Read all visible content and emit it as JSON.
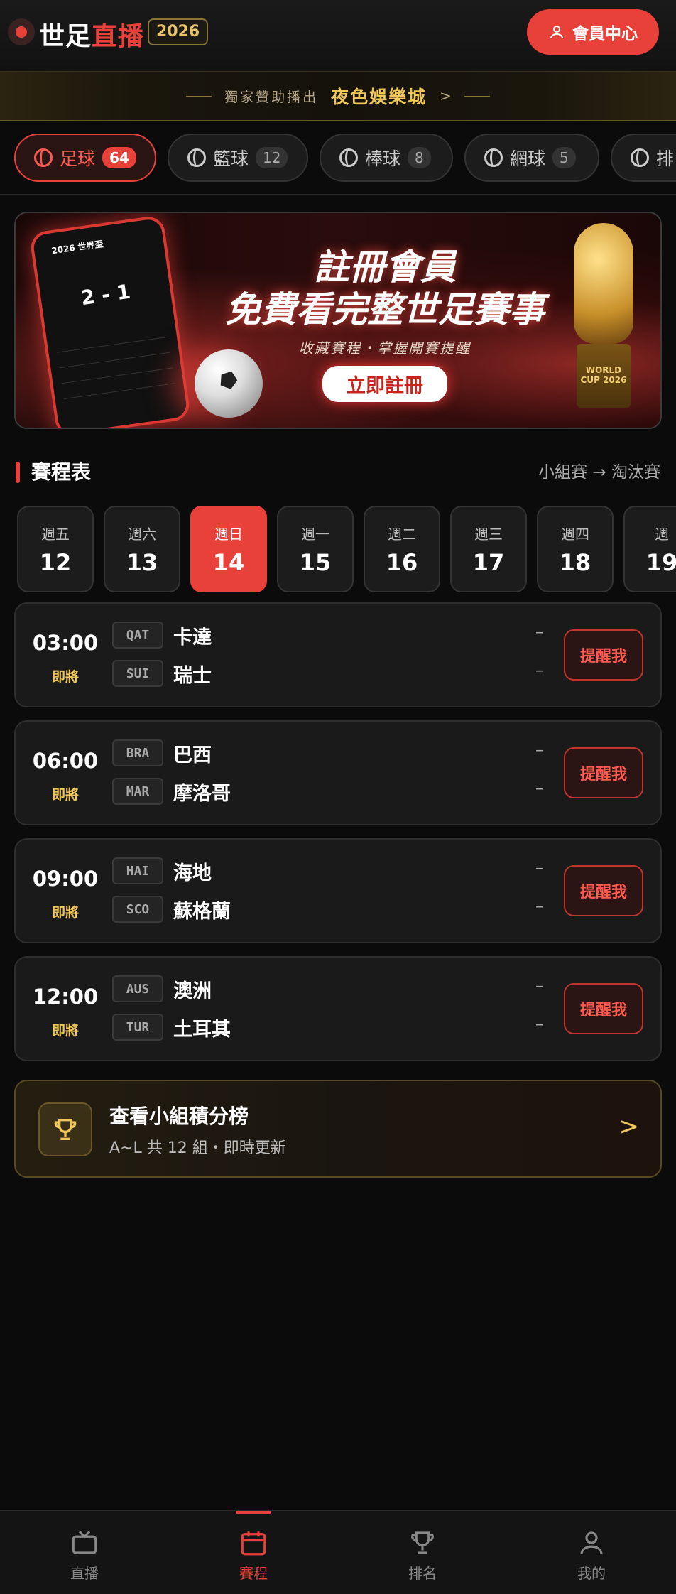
{
  "header": {
    "brand_a": "世足",
    "brand_b": "直播",
    "year": "2026",
    "member_button": "會員中心"
  },
  "sponsor": {
    "label": "獨家贊助播出",
    "name": "夜色娛樂城",
    "arrow": ">"
  },
  "sports_tabs": [
    {
      "label": "足球",
      "count": "64"
    },
    {
      "label": "籃球",
      "count": "12"
    },
    {
      "label": "棒球",
      "count": "8"
    },
    {
      "label": "網球",
      "count": "5"
    },
    {
      "label": "排"
    }
  ],
  "banner": {
    "phone_title": "2026 世界盃",
    "phone_score": "2 - 1",
    "headline_1": "註冊會員",
    "headline_2": "免費看完整世足賽事",
    "subline": "收藏賽程・掌握開賽提醒",
    "cta": "立即註冊",
    "trophy_text": "WORLD CUP 2026"
  },
  "schedule": {
    "title": "賽程表",
    "stage_link": "小組賽 → 淘汰賽",
    "days": [
      {
        "weekday": "週五",
        "date": "12"
      },
      {
        "weekday": "週六",
        "date": "13"
      },
      {
        "weekday": "週日",
        "date": "14"
      },
      {
        "weekday": "週一",
        "date": "15"
      },
      {
        "weekday": "週二",
        "date": "16"
      },
      {
        "weekday": "週三",
        "date": "17"
      },
      {
        "weekday": "週四",
        "date": "18"
      },
      {
        "weekday": "週",
        "date": "19"
      }
    ],
    "selected_day": "14",
    "matches": [
      {
        "time": "03:00",
        "status": "即將",
        "home_code": "QAT",
        "home": "卡達",
        "away_code": "SUI",
        "away": "瑞士",
        "home_score": "–",
        "away_score": "–",
        "action": "提醒我"
      },
      {
        "time": "06:00",
        "status": "即將",
        "home_code": "BRA",
        "home": "巴西",
        "away_code": "MAR",
        "away": "摩洛哥",
        "home_score": "–",
        "away_score": "–",
        "action": "提醒我"
      },
      {
        "time": "09:00",
        "status": "即將",
        "home_code": "HAI",
        "home": "海地",
        "away_code": "SCO",
        "away": "蘇格蘭",
        "home_score": "–",
        "away_score": "–",
        "action": "提醒我"
      },
      {
        "time": "12:00",
        "status": "即將",
        "home_code": "AUS",
        "home": "澳洲",
        "away_code": "TUR",
        "away": "土耳其",
        "home_score": "–",
        "away_score": "–",
        "action": "提醒我"
      }
    ]
  },
  "standings": {
    "title": "查看小組積分榜",
    "subtitle": "A~L 共 12 組・即時更新",
    "arrow": ">"
  },
  "bottom_nav": [
    {
      "label": "直播",
      "icon": "tv-icon"
    },
    {
      "label": "賽程",
      "icon": "calendar-icon"
    },
    {
      "label": "排名",
      "icon": "trophy-icon"
    },
    {
      "label": "我的",
      "icon": "user-icon"
    }
  ],
  "colors": {
    "accent": "#e8413a",
    "gold": "#f0c85a",
    "background": "#0b0b0b"
  }
}
